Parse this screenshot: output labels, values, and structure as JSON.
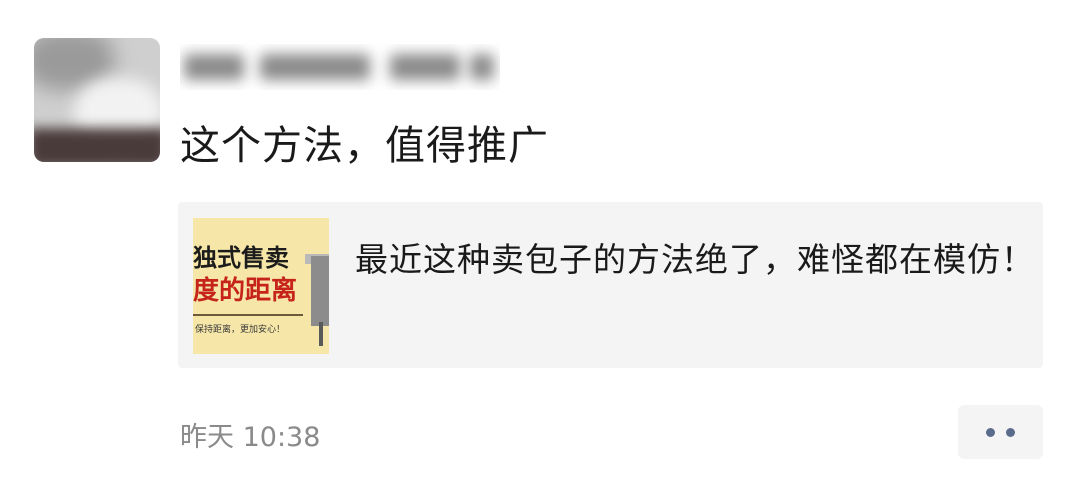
{
  "post": {
    "text": "这个方法，值得推广",
    "timestamp": "昨天 10:38"
  },
  "shared_article": {
    "title": "最近这种卖包子的方法绝了，难怪都在模仿！",
    "thumbnail": {
      "line1": "独式售卖",
      "line2": "度的距离",
      "line3": "保持距离，更加安心！"
    }
  },
  "actions": {
    "more_icon": "more-dots-icon"
  },
  "colors": {
    "card_background": "#f4f4f4",
    "timestamp": "#8a8a8a",
    "more_dots": "#5a6b8c",
    "thumbnail_background": "#f6e7a8",
    "thumbnail_accent": "#c6241a"
  }
}
